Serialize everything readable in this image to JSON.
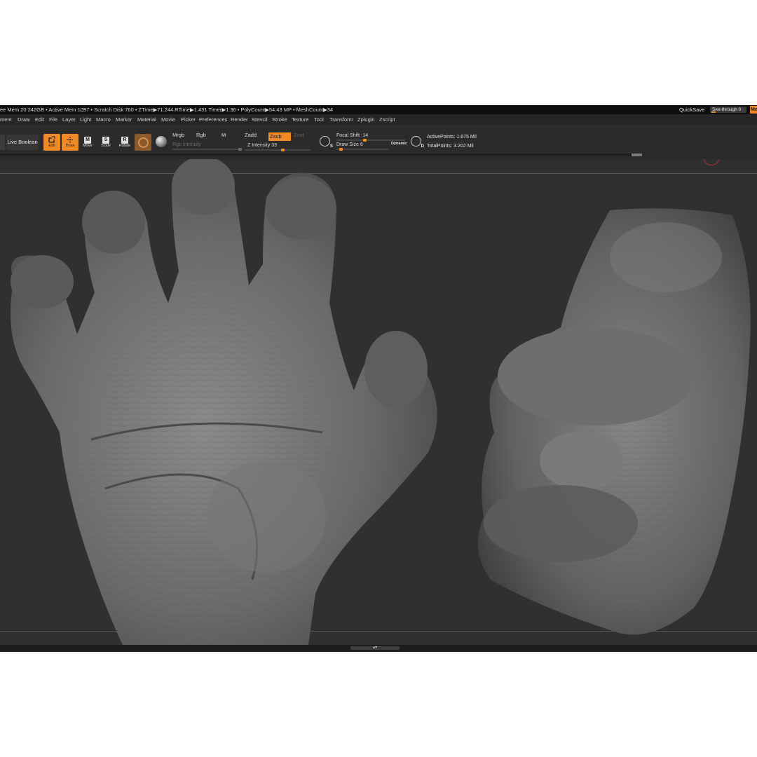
{
  "status_bar": {
    "stats": "ee Mem 20.242GB • Active Mem 1097 • Scratch Disk 760 • ZTime▶71.244 RTime▶1.431 Timer▶1.36 • PolyCount▶54.43 MP • MeshCount▶34",
    "quicksave": "QuickSave",
    "see_through": "See-through  0",
    "right_button": "Me"
  },
  "menu": {
    "items": [
      "ment",
      "Draw",
      "Edit",
      "File",
      "Layer",
      "Light",
      "Macro",
      "Marker",
      "Material",
      "Movie",
      "Picker",
      "Preferences",
      "Render",
      "Stencil",
      "Stroke",
      "Texture",
      "Tool",
      "Transform",
      "Zplugin",
      "Zscript"
    ]
  },
  "toolbar": {
    "live_boolean": "Live Boolean",
    "edit": "Edit",
    "draw": "Draw",
    "move": "Move",
    "scale": "Scale",
    "rotate": "Rotate",
    "mrgb": "Mrgb",
    "rgb": "Rgb",
    "m": "M",
    "rgb_intensity": "Rgb Intensity",
    "zadd": "Zadd",
    "zsub": "Zsub",
    "zcut": "Zcut",
    "z_intensity": "Z Intensity 33",
    "z_intensity_value": 33,
    "focal_shift": "Focal Shift -14",
    "focal_shift_value": -14,
    "draw_size": "Draw Size 6",
    "draw_size_value": 6,
    "dynamic": "Dynamic",
    "active_points": "ActivePoints: 1.675 Mil",
    "total_points": "TotalPoints: 3.202 Mil",
    "s_tag": "S",
    "d_tag": "D"
  },
  "colors": {
    "accent": "#f08a24",
    "background": "#303030",
    "ui_dark": "#0e0e0e"
  },
  "viewport": {
    "models": [
      "open-hand-sculpt",
      "clenched-fist-sculpt"
    ]
  }
}
